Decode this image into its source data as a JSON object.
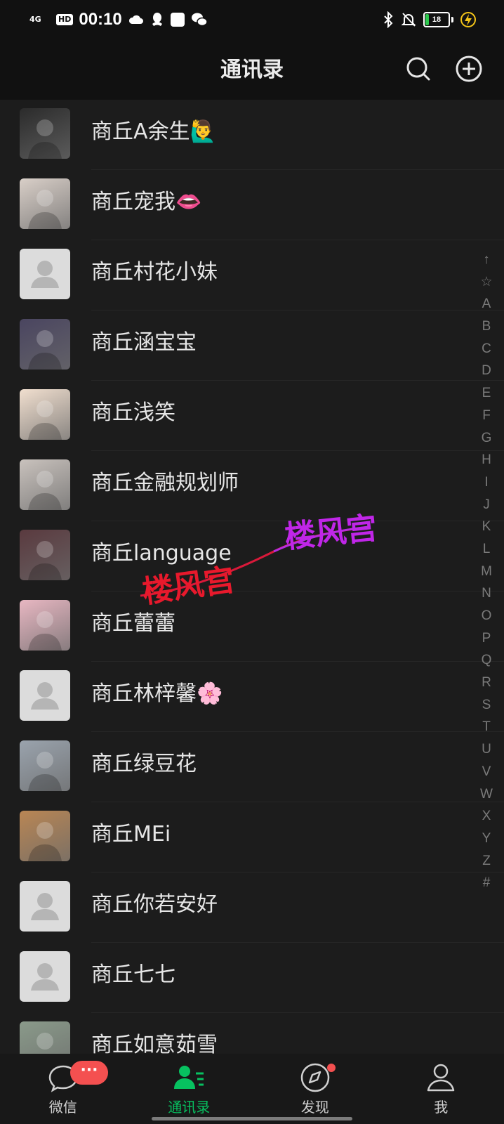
{
  "status_bar": {
    "network": "4G",
    "hd": "HD",
    "time": "00:10",
    "battery_level": "18",
    "battery_fraction": 0.18
  },
  "header": {
    "title": "通讯录",
    "search_icon": "search-icon",
    "add_icon": "add-icon"
  },
  "contacts": [
    {
      "name": "商丘A余生🙋‍♂️",
      "avatar": "photo",
      "color": "#2b2b2b"
    },
    {
      "name": "商丘宠我👄",
      "avatar": "photo",
      "color": "#d9cfc8"
    },
    {
      "name": "商丘村花小妹",
      "avatar": "default",
      "color": "#dcdcdc"
    },
    {
      "name": "商丘涵宝宝",
      "avatar": "photo",
      "color": "#4a4560"
    },
    {
      "name": "商丘浅笑",
      "avatar": "photo",
      "color": "#f1dfcf"
    },
    {
      "name": "商丘金融规划师",
      "avatar": "photo",
      "color": "#c9c2bd"
    },
    {
      "name": "商丘language",
      "avatar": "photo",
      "color": "#5a3a3f"
    },
    {
      "name": "商丘蕾蕾",
      "avatar": "photo",
      "color": "#e8b7c2"
    },
    {
      "name": "商丘林梓馨🌸",
      "avatar": "default",
      "color": "#dcdcdc"
    },
    {
      "name": "商丘绿豆花",
      "avatar": "photo",
      "color": "#9aa3ad"
    },
    {
      "name": "商丘MEi",
      "avatar": "photo",
      "color": "#b98654"
    },
    {
      "name": "商丘你若安好",
      "avatar": "default",
      "color": "#dcdcdc"
    },
    {
      "name": "商丘七七",
      "avatar": "default",
      "color": "#dcdcdc"
    },
    {
      "name": "商丘如意茹雪",
      "avatar": "photo",
      "color": "#8a9a8a"
    }
  ],
  "index_bar": [
    "↑",
    "☆",
    "A",
    "B",
    "C",
    "D",
    "E",
    "F",
    "G",
    "H",
    "I",
    "J",
    "K",
    "L",
    "M",
    "N",
    "O",
    "P",
    "Q",
    "R",
    "S",
    "T",
    "U",
    "V",
    "W",
    "X",
    "Y",
    "Z",
    "#"
  ],
  "watermark": {
    "text_red": "楼风宫",
    "text_purple": "楼风宫"
  },
  "tabs": [
    {
      "label": "微信",
      "icon": "chat-icon",
      "active": false
    },
    {
      "label": "通讯录",
      "icon": "contacts-icon",
      "active": true
    },
    {
      "label": "发现",
      "icon": "compass-icon",
      "active": false
    },
    {
      "label": "我",
      "icon": "person-icon",
      "active": false
    }
  ],
  "chat_badge": "···",
  "colors": {
    "accent": "#07c160",
    "badge": "#f45050",
    "background": "#1c1c1c"
  }
}
